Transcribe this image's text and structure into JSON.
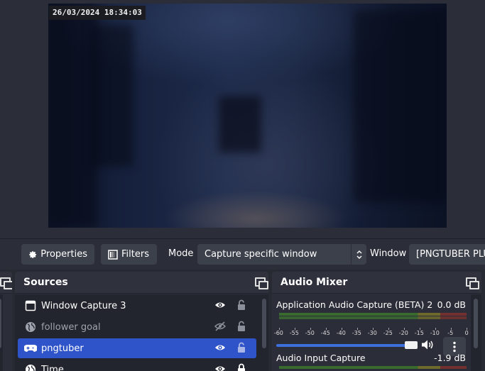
{
  "preview": {
    "timestamp": "26/03/2024 18:34:03"
  },
  "context_bar": {
    "properties_label": "Properties",
    "filters_label": "Filters",
    "mode_label": "Mode",
    "mode_value": "Capture specific window",
    "window_label": "Window",
    "window_value": "[PNGTUBER PLUS"
  },
  "sources": {
    "title": "Sources",
    "items": [
      {
        "name": "Window Capture 3",
        "icon": "window-icon",
        "visible": true,
        "locked": false
      },
      {
        "name": "follower goal",
        "icon": "browser-globe-icon",
        "visible": false,
        "locked": false
      },
      {
        "name": "pngtuber",
        "icon": "gamepad-icon",
        "visible": true,
        "locked": false,
        "selected": true
      },
      {
        "name": "Time",
        "icon": "browser-globe-icon",
        "visible": true,
        "locked": true
      }
    ]
  },
  "audio_mixer": {
    "title": "Audio Mixer",
    "meter_scale": [
      "-60",
      "-55",
      "-50",
      "-45",
      "-40",
      "-35",
      "-30",
      "-25",
      "-20",
      "-15",
      "-10",
      "-5",
      "0"
    ],
    "channels": [
      {
        "name": "Application Audio Capture (BETA) 2",
        "db": "0.0 dB",
        "volume_fraction": 1.0
      },
      {
        "name": "Audio Input Capture",
        "db": "-1.9 dB"
      }
    ]
  },
  "colors": {
    "accent_selected": "#2f53c9",
    "slider": "#3c6fd9",
    "panel": "#2b2e38",
    "list_bg": "#22252d"
  }
}
